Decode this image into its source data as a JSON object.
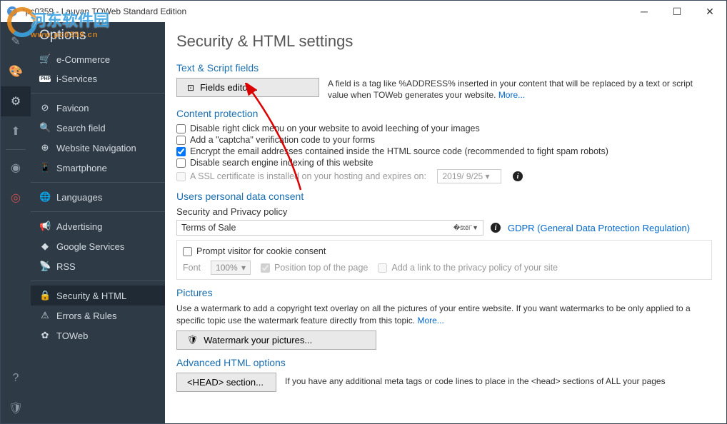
{
  "window": {
    "title": "*pc0359 - Lauyan TOWeb Standard Edition"
  },
  "sidebar": {
    "header": "Options",
    "groups": [
      [
        {
          "icon": "🛒",
          "label": "e-Commerce"
        },
        {
          "icon": "PHP",
          "label": "i-Services"
        }
      ],
      [
        {
          "icon": "⊘",
          "label": "Favicon"
        },
        {
          "icon": "🔍",
          "label": "Search field"
        },
        {
          "icon": "⊕",
          "label": "Website Navigation"
        },
        {
          "icon": "📱",
          "label": "Smartphone"
        }
      ],
      [
        {
          "icon": "🌐",
          "label": "Languages"
        }
      ],
      [
        {
          "icon": "📢",
          "label": "Advertising"
        },
        {
          "icon": "◆",
          "label": "Google Services"
        },
        {
          "icon": "📡",
          "label": "RSS"
        }
      ],
      [
        {
          "icon": "🔒",
          "label": "Security & HTML",
          "selected": true
        },
        {
          "icon": "⚠",
          "label": "Errors & Rules"
        },
        {
          "icon": "✿",
          "label": "TOWeb"
        }
      ]
    ]
  },
  "page": {
    "title": "Security & HTML settings",
    "text_script": {
      "heading": "Text & Script fields",
      "button": "Fields editor...",
      "desc": "A field is a tag like %ADDRESS% inserted in your content that will be replaced by a text or script value when TOWeb generates your website. ",
      "more": "More..."
    },
    "protection": {
      "heading": "Content protection",
      "chk1": "Disable right click menu on your website to avoid leeching of your images",
      "chk2": "Add a \"captcha\" verification code to your forms",
      "chk3": "Encrypt the email addresses contained inside the HTML source code (recommended to fight spam robots)",
      "chk4": "Disable search engine indexing of this website",
      "ssl": "A SSL certificate is installed on your hosting and expires on:",
      "ssl_date": "2019/ 9/25"
    },
    "consent": {
      "heading": "Users personal data consent",
      "policy_label": "Security and Privacy policy",
      "policy_value": "Terms of Sale",
      "gdpr": "GDPR (General Data Protection Regulation)",
      "prompt": "Prompt visitor for cookie consent",
      "font_label": "Font",
      "font_value": "100%",
      "pos": "Position top of the page",
      "addlink": "Add a link to the privacy policy of your site"
    },
    "pictures": {
      "heading": "Pictures",
      "desc": "Use a watermark to add a copyright text overlay on all the pictures of your entire website. If you want watermarks to be only applied to a specific topic use the watermark feature directly from this topic. ",
      "more": "More...",
      "button": "Watermark your pictures..."
    },
    "advanced": {
      "heading": "Advanced HTML options",
      "button": "<HEAD> section...",
      "desc": "If you have any additional meta tags or code lines to place in the <head> sections of ALL your pages"
    }
  },
  "watermark": {
    "line1": "河东软件园",
    "line2": "www.pc0359.cn"
  }
}
